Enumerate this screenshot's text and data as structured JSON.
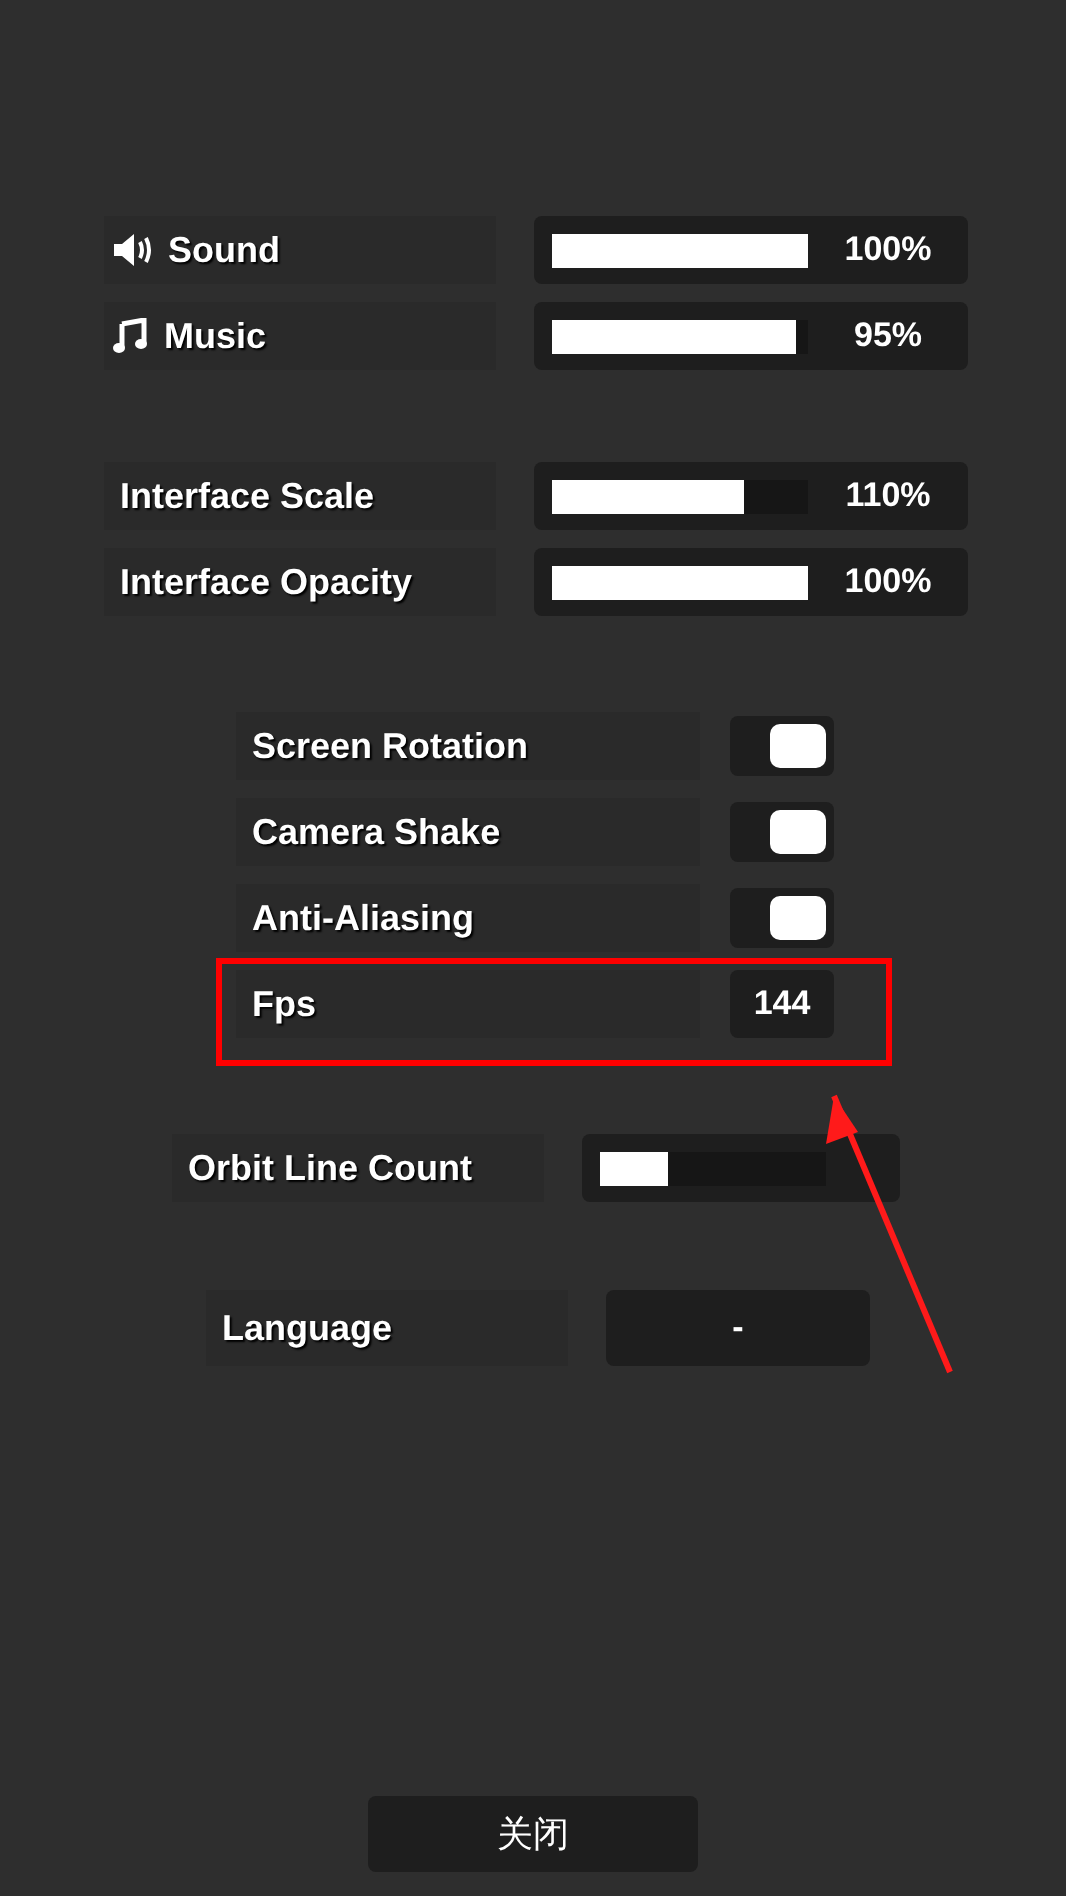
{
  "audio": [
    {
      "kind": "sound",
      "label": "Sound",
      "level": 1,
      "reading": "100%"
    },
    {
      "kind": "music",
      "label": "Music",
      "level": 0.95,
      "reading": "95%"
    }
  ],
  "interface": [
    {
      "label": "Interface Scale",
      "level": 0.75,
      "reading": "110%"
    },
    {
      "label": "Interface Opacity",
      "level": 1,
      "reading": "100%"
    }
  ],
  "toggles": [
    {
      "label": "Screen Rotation",
      "on": true
    },
    {
      "label": "Camera Shake",
      "on": true
    },
    {
      "label": "Anti-Aliasing",
      "on": true
    }
  ],
  "fps": {
    "label": "Fps",
    "value": "144"
  },
  "orbit_line_count": {
    "label": "Orbit Line Count",
    "level": 0.3
  },
  "language": {
    "label": "Language",
    "value": "-"
  },
  "close_button": "关闭"
}
